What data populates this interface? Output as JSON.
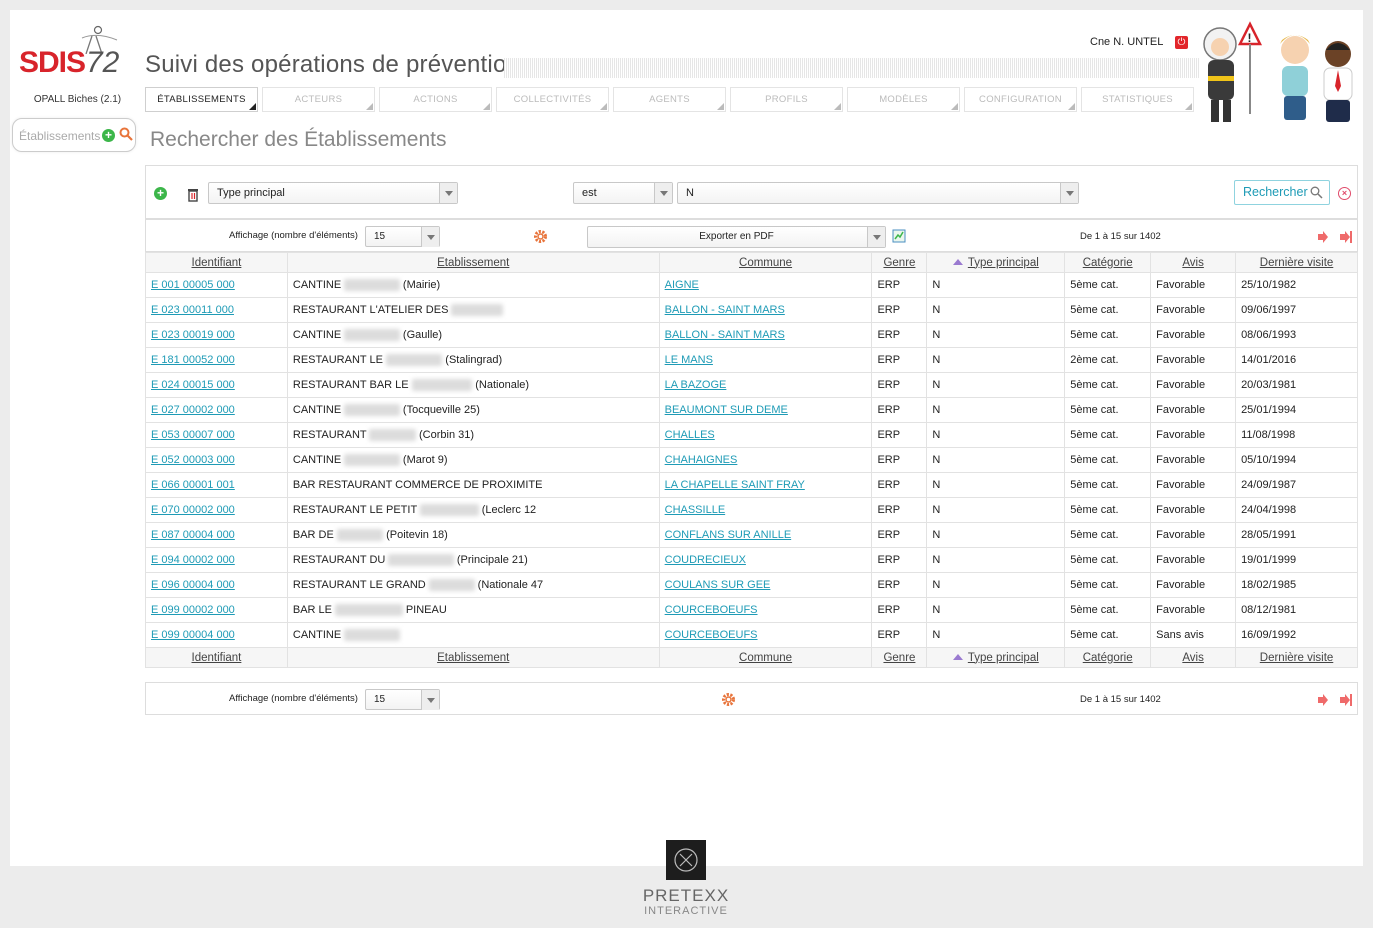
{
  "brand": {
    "logo_text": "SDIS",
    "logo_number": "72",
    "version": "OPALL Biches (2.1)"
  },
  "sidebar": {
    "search_placeholder": "Établissements"
  },
  "header": {
    "app_title": "Suivi des opérations de prévention",
    "user": "Cne N. UNTEL",
    "nav": [
      {
        "label": "ÉTABLISSEMENTS",
        "active": true
      },
      {
        "label": "ACTEURS",
        "active": false
      },
      {
        "label": "ACTIONS",
        "active": false
      },
      {
        "label": "COLLECTIVITÉS",
        "active": false
      },
      {
        "label": "AGENTS",
        "active": false
      },
      {
        "label": "PROFILS",
        "active": false
      },
      {
        "label": "MODÈLES",
        "active": false
      },
      {
        "label": "CONFIGURATION",
        "active": false
      },
      {
        "label": "STATISTIQUES",
        "active": false
      }
    ]
  },
  "page_title": "Rechercher des Établissements",
  "criteria": {
    "field": "Type principal",
    "operator": "est",
    "value": "N",
    "search_button": "Rechercher"
  },
  "pager": {
    "label": "Affichage (nombre d'éléments)",
    "page_size": "15",
    "export": "Exporter en PDF",
    "range": "De 1 à 15 sur 1402"
  },
  "table": {
    "columns": [
      "Identifiant",
      "Etablissement",
      "Commune",
      "Genre",
      "Type principal",
      "Catégorie",
      "Avis",
      "Dernière visite"
    ],
    "rows": [
      {
        "id": "E 001 00005 000",
        "etab_a": "CANTINE ",
        "etab_b": "SCOLAIRE",
        "etab_c": " (Mairie)",
        "commune": "AIGNE",
        "genre": "ERP",
        "type": "N",
        "cat": "5ème cat.",
        "avis": "Favorable",
        "date": "25/10/1982"
      },
      {
        "id": "E 023 00011 000",
        "etab_a": "RESTAURANT L'ATELIER DES ",
        "etab_b": "SAVEURS",
        "etab_c": "",
        "commune": "BALLON - SAINT MARS",
        "genre": "ERP",
        "type": "N",
        "cat": "5ème cat.",
        "avis": "Favorable",
        "date": "09/06/1997"
      },
      {
        "id": "E 023 00019 000",
        "etab_a": "CANTINE ",
        "etab_b": "SCOLAIRE",
        "etab_c": " (Gaulle)",
        "commune": "BALLON - SAINT MARS",
        "genre": "ERP",
        "type": "N",
        "cat": "5ème cat.",
        "avis": "Favorable",
        "date": "08/06/1993"
      },
      {
        "id": "E 181 00052 000",
        "etab_a": "RESTAURANT LE ",
        "etab_b": "CENOMAN",
        "etab_c": " (Stalingrad)",
        "commune": "LE MANS",
        "genre": "ERP",
        "type": "N",
        "cat": "2ème cat.",
        "avis": "Favorable",
        "date": "14/01/2016"
      },
      {
        "id": "E 024 00015 000",
        "etab_a": "RESTAURANT BAR LE ",
        "etab_b": "DEAUVILLE",
        "etab_c": " (Nationale)",
        "commune": "LA BAZOGE",
        "genre": "ERP",
        "type": "N",
        "cat": "5ème cat.",
        "avis": "Favorable",
        "date": "20/03/1981"
      },
      {
        "id": "E 027 00002 000",
        "etab_a": "CANTINE ",
        "etab_b": "SCOLAIRE",
        "etab_c": " (Tocqueville 25)",
        "commune": "BEAUMONT SUR DEME",
        "genre": "ERP",
        "type": "N",
        "cat": "5ème cat.",
        "avis": "Favorable",
        "date": "25/01/1994"
      },
      {
        "id": "E 053 00007 000",
        "etab_a": "RESTAURANT ",
        "etab_b": "MENANT",
        "etab_c": " (Corbin 31)",
        "commune": "CHALLES",
        "genre": "ERP",
        "type": "N",
        "cat": "5ème cat.",
        "avis": "Favorable",
        "date": "11/08/1998"
      },
      {
        "id": "E 052 00003 000",
        "etab_a": "CANTINE ",
        "etab_b": "SCOLAIRE",
        "etab_c": " (Marot 9)",
        "commune": "CHAHAIGNES",
        "genre": "ERP",
        "type": "N",
        "cat": "5ème cat.",
        "avis": "Favorable",
        "date": "05/10/1994"
      },
      {
        "id": "E 066 00001 001",
        "etab_a": "BAR RESTAURANT COMMERCE DE PROXIMITE",
        "etab_b": "",
        "etab_c": "",
        "commune": "LA CHAPELLE SAINT FRAY",
        "genre": "ERP",
        "type": "N",
        "cat": "5ème cat.",
        "avis": "Favorable",
        "date": "24/09/1987"
      },
      {
        "id": "E 070 00002 000",
        "etab_a": "RESTAURANT LE PETIT ",
        "etab_b": "ROBINSON",
        "etab_c": " (Leclerc 12",
        "commune": "CHASSILLE",
        "genre": "ERP",
        "type": "N",
        "cat": "5ème cat.",
        "avis": "Favorable",
        "date": "24/04/1998"
      },
      {
        "id": "E 087 00004 000",
        "etab_a": "BAR DE ",
        "etab_b": "L'ANILLE",
        "etab_c": " (Poitevin 18)",
        "commune": "CONFLANS SUR ANILLE",
        "genre": "ERP",
        "type": "N",
        "cat": "5ème cat.",
        "avis": "Favorable",
        "date": "28/05/1991"
      },
      {
        "id": "E 094 00002 000",
        "etab_a": "RESTAURANT DU ",
        "etab_b": "COMMERCE",
        "etab_c": " (Principale 21)",
        "commune": "COUDRECIEUX",
        "genre": "ERP",
        "type": "N",
        "cat": "5ème cat.",
        "avis": "Favorable",
        "date": "19/01/1999"
      },
      {
        "id": "E 096 00004 000",
        "etab_a": "RESTAURANT LE GRAND ",
        "etab_b": "VENEUR",
        "etab_c": " (Nationale 47",
        "commune": "COULANS SUR GEE",
        "genre": "ERP",
        "type": "N",
        "cat": "5ème cat.",
        "avis": "Favorable",
        "date": "18/02/1985"
      },
      {
        "id": "E 099 00002 000",
        "etab_a": "BAR LE ",
        "etab_b": "SOLEIL D'OR",
        "etab_c": " PINEAU",
        "commune": "COURCEBOEUFS",
        "genre": "ERP",
        "type": "N",
        "cat": "5ème cat.",
        "avis": "Favorable",
        "date": "08/12/1981"
      },
      {
        "id": "E 099 00004 000",
        "etab_a": "CANTINE ",
        "etab_b": "SCOLAIRE",
        "etab_c": "",
        "commune": "COURCEBOEUFS",
        "genre": "ERP",
        "type": "N",
        "cat": "5ème cat.",
        "avis": "Sans avis",
        "date": "16/09/1992"
      }
    ]
  },
  "footer": {
    "brand": "PRETEXX",
    "sub": "INTERACTIVE"
  },
  "colors": {
    "link": "#1e9bb6",
    "logo_red": "#d8242b",
    "sort_arrow": "#9a7ad0",
    "gear": "#e8743b"
  }
}
